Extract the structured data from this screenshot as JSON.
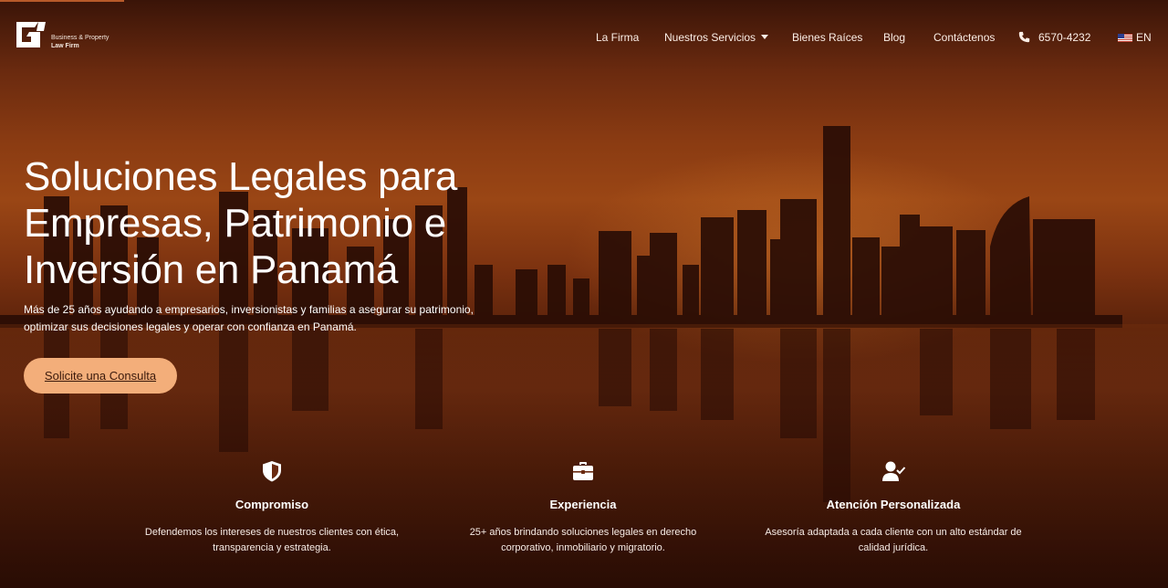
{
  "brand": {
    "line1": "Business & Property",
    "line2": "Law Firm"
  },
  "nav": {
    "items": [
      "La Firma",
      "Nuestros Servicios",
      "Bienes Raíces",
      "Blog",
      "Contáctenos"
    ],
    "phone": "6570-4232",
    "language": "EN"
  },
  "hero": {
    "title": "Soluciones Legales para Empresas, Patrimonio e Inversión en Panamá",
    "subtitle": "Más de 25 años ayudando a empresarios, inversionistas y familias a asegurar su patrimonio, optimizar sus decisiones legales y operar con confianza en Panamá.",
    "cta": "Solicite una Consulta"
  },
  "features": [
    {
      "icon": "shield-icon",
      "title": "Compromiso",
      "description": "Defendemos los intereses de nuestros clientes con ética, transparencia y estrategia."
    },
    {
      "icon": "briefcase-icon",
      "title": "Experiencia",
      "description": "25+ años brindando soluciones legales en derecho corporativo, inmobiliario y migratorio."
    },
    {
      "icon": "user-check-icon",
      "title": "Atención Personalizada",
      "description": "Asesoría adaptada a cada cliente con un alto estándar de calidad jurídica."
    }
  ],
  "colors": {
    "cta_background": "#f3ae7a",
    "cta_text": "#3b1a0c",
    "sky": "#8a3b12"
  }
}
